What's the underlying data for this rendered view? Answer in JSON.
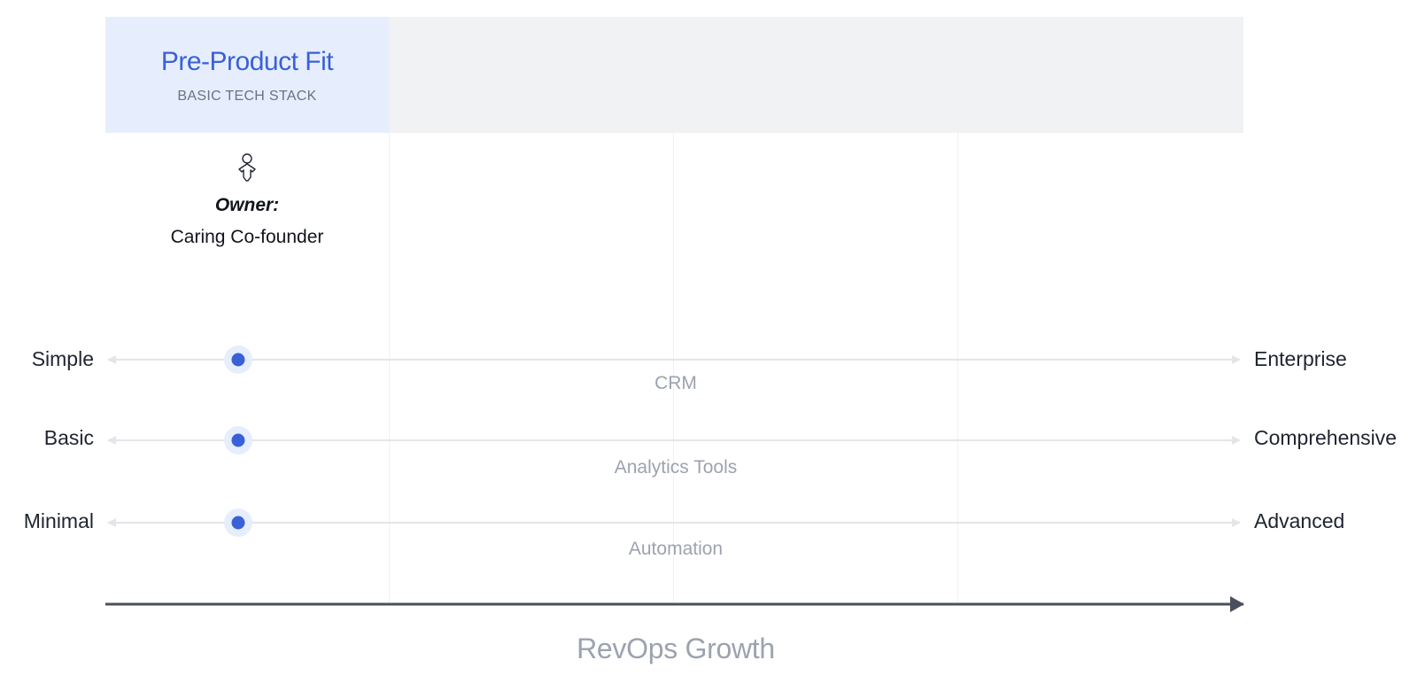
{
  "stage": {
    "title": "Pre-Product Fit",
    "subtitle": "BASIC TECH STACK",
    "owner_label": "Owner:",
    "owner_name": "Caring Co-founder",
    "owner_icon": "person-icon"
  },
  "scales": [
    {
      "name": "CRM",
      "left": "Simple",
      "right": "Enterprise",
      "level": 0.115
    },
    {
      "name": "Analytics Tools",
      "left": "Basic",
      "right": "Comprehensive",
      "level": 0.115
    },
    {
      "name": "Automation",
      "left": "Minimal",
      "right": "Advanced",
      "level": 0.115
    }
  ],
  "axis": {
    "label": "RevOps Growth"
  },
  "colors": {
    "accent": "#3a60d7",
    "active_band": "#e6eefd",
    "inactive_band": "#f1f2f4",
    "track": "#e3e5e9",
    "axis": "#4a4f5c",
    "muted_text": "#9ca3af"
  }
}
